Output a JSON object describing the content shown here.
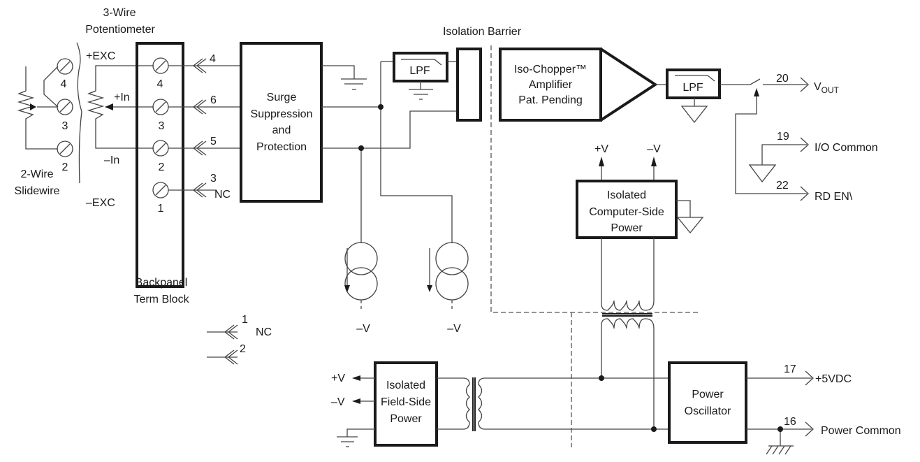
{
  "labels": {
    "pot_title_1": "3-Wire",
    "pot_title_2": "Potentiometer",
    "plus_exc": "+EXC",
    "plus_in": "+In",
    "minus_in": "–In",
    "minus_exc": "–EXC",
    "slidewire_1": "2-Wire",
    "slidewire_2": "Slidewire",
    "backpanel_1": "Backpanel",
    "backpanel_2": "Term Block",
    "isolation_barrier": "Isolation Barrier",
    "nc": "NC",
    "minus_v": "–V",
    "plus_v": "+V"
  },
  "slidewire_terminals": [
    "4",
    "3",
    "2"
  ],
  "term_block_terminals": [
    "4",
    "3",
    "2",
    "1"
  ],
  "connector_pins": [
    "4",
    "6",
    "5",
    "3"
  ],
  "extra_pins": [
    "1",
    "2"
  ],
  "blocks": {
    "surge": [
      "Surge",
      "Suppression",
      "and",
      "Protection"
    ],
    "lpf": "LPF",
    "chopper": [
      "Iso-Chopper™",
      "Amplifier",
      "Pat. Pending"
    ],
    "computer_power": [
      "Isolated",
      "Computer-Side",
      "Power"
    ],
    "field_power": [
      "Isolated",
      "Field-Side",
      "Power"
    ],
    "oscillator": [
      "Power",
      "Oscillator"
    ]
  },
  "outputs": [
    {
      "pin": "20",
      "label": "V",
      "sub": "OUT"
    },
    {
      "pin": "19",
      "label": "I/O Common"
    },
    {
      "pin": "22",
      "label": "RD EN\\"
    },
    {
      "pin": "17",
      "label": "+5VDC"
    },
    {
      "pin": "16",
      "label": "Power Common"
    }
  ]
}
